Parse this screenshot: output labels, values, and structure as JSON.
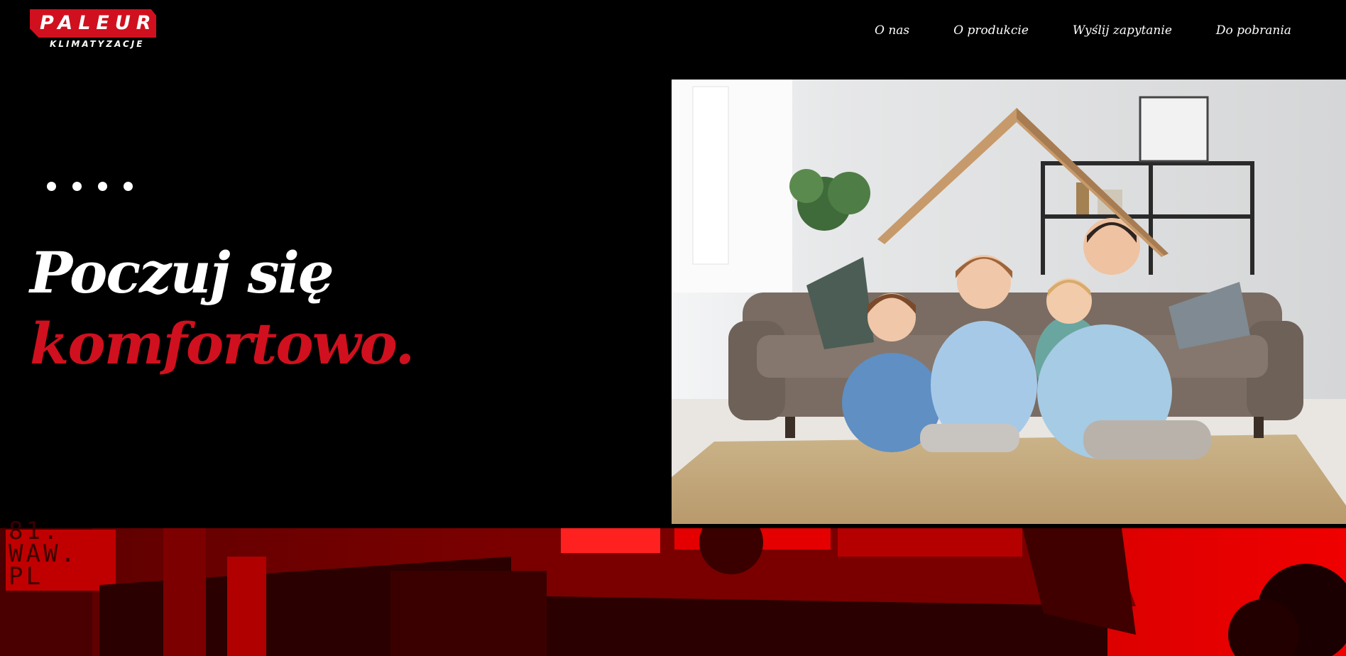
{
  "header": {
    "logo": {
      "wordmark": "PALEUR",
      "subtitle": "KLIMATYZACJE"
    },
    "nav": [
      {
        "label": "O nas"
      },
      {
        "label": "O produkcie"
      },
      {
        "label": "Wyślij zapytanie"
      },
      {
        "label": "Do pobrania"
      }
    ]
  },
  "hero": {
    "slider_dots": 4,
    "heading_line1": "Poczuj się",
    "heading_line2": "komfortowo.",
    "photo_icon": "family-under-paper-roof-photo"
  },
  "band": {
    "sign_lines": [
      "81.",
      "WAW.",
      "PL"
    ],
    "photo_icon": "red-tinted-building-photo"
  },
  "colors": {
    "background": "#000000",
    "accent_red": "#d0101e",
    "text": "#ffffff"
  }
}
